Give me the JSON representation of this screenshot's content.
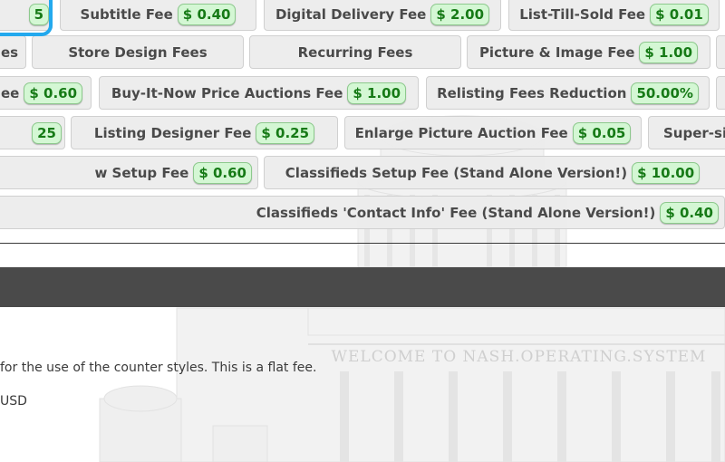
{
  "tabs": {
    "row1": [
      {
        "label": "",
        "price": "5"
      },
      {
        "label": "Subtitle Fee",
        "price": "$ 0.40"
      },
      {
        "label": "Digital Delivery Fee",
        "price": "$ 2.00"
      },
      {
        "label": "List-Till-Sold Fee",
        "price": "$ 0.01"
      }
    ],
    "row2": [
      {
        "label": "es",
        "price": ""
      },
      {
        "label": "Store Design Fees",
        "price": ""
      },
      {
        "label": "Recurring Fees",
        "price": ""
      },
      {
        "label": "Picture & Image Fee",
        "price": "$ 1.00"
      }
    ],
    "row3": [
      {
        "label": "ee",
        "price": "$ 0.60"
      },
      {
        "label": "Buy-It-Now Price Auctions Fee",
        "price": "$ 1.00"
      },
      {
        "label": "Relisting Fees Reduction",
        "price": "50.00%"
      }
    ],
    "row4": [
      {
        "label": "",
        "price": "25"
      },
      {
        "label": "Listing Designer Fee",
        "price": "$ 0.25"
      },
      {
        "label": "Enlarge Picture Auction Fee",
        "price": "$ 0.05"
      },
      {
        "label": "Super-si",
        "price": ""
      }
    ],
    "row5": [
      {
        "label": "w Setup Fee",
        "price": "$ 0.60"
      },
      {
        "label": "Classifieds Setup Fee (Stand Alone Version!)",
        "price": "$ 10.00"
      }
    ],
    "row6": [
      {
        "label": "Classifieds 'Contact Info' Fee (Stand Alone Version!)",
        "price": "$ 0.40"
      }
    ]
  },
  "background": {
    "caption": "WELCOME TO NASH.OPERATING.SYSTEM"
  },
  "content": {
    "description": "for the use of the counter styles. This is a flat fee.",
    "price": "USD"
  },
  "colors": {
    "badge_bg": "#d4f7d4",
    "badge_text": "#167a16",
    "selected_outline": "#23a9ee",
    "dark_bar": "#4a4a4a"
  }
}
